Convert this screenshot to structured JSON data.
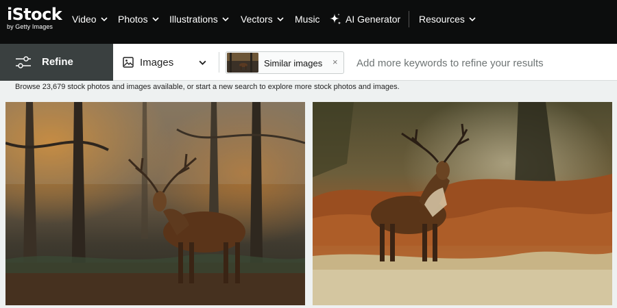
{
  "brand": {
    "name": "iStock",
    "tagline": "by Getty Images"
  },
  "nav": {
    "items": [
      {
        "label": "Video",
        "has_menu": true
      },
      {
        "label": "Photos",
        "has_menu": true
      },
      {
        "label": "Illustrations",
        "has_menu": true
      },
      {
        "label": "Vectors",
        "has_menu": true
      },
      {
        "label": "Music",
        "has_menu": false
      },
      {
        "label": "AI Generator",
        "has_menu": false,
        "icon": "sparkle-icon"
      },
      {
        "label": "Resources",
        "has_menu": true
      }
    ]
  },
  "refine": {
    "label": "Refine",
    "icon": "sliders-icon"
  },
  "media_type": {
    "selected": "Images",
    "icon": "image-icon"
  },
  "chip": {
    "label": "Similar images",
    "close": "×"
  },
  "search": {
    "placeholder": "Add more keywords to refine your results",
    "value": ""
  },
  "results": {
    "description": "Browse 23,679 stock photos and images available, or start a new search to explore more stock photos and images."
  },
  "colors": {
    "nav_bg": "#0c0d0d",
    "refine_bg": "#3a4040",
    "page_bg": "#eef1f1"
  }
}
